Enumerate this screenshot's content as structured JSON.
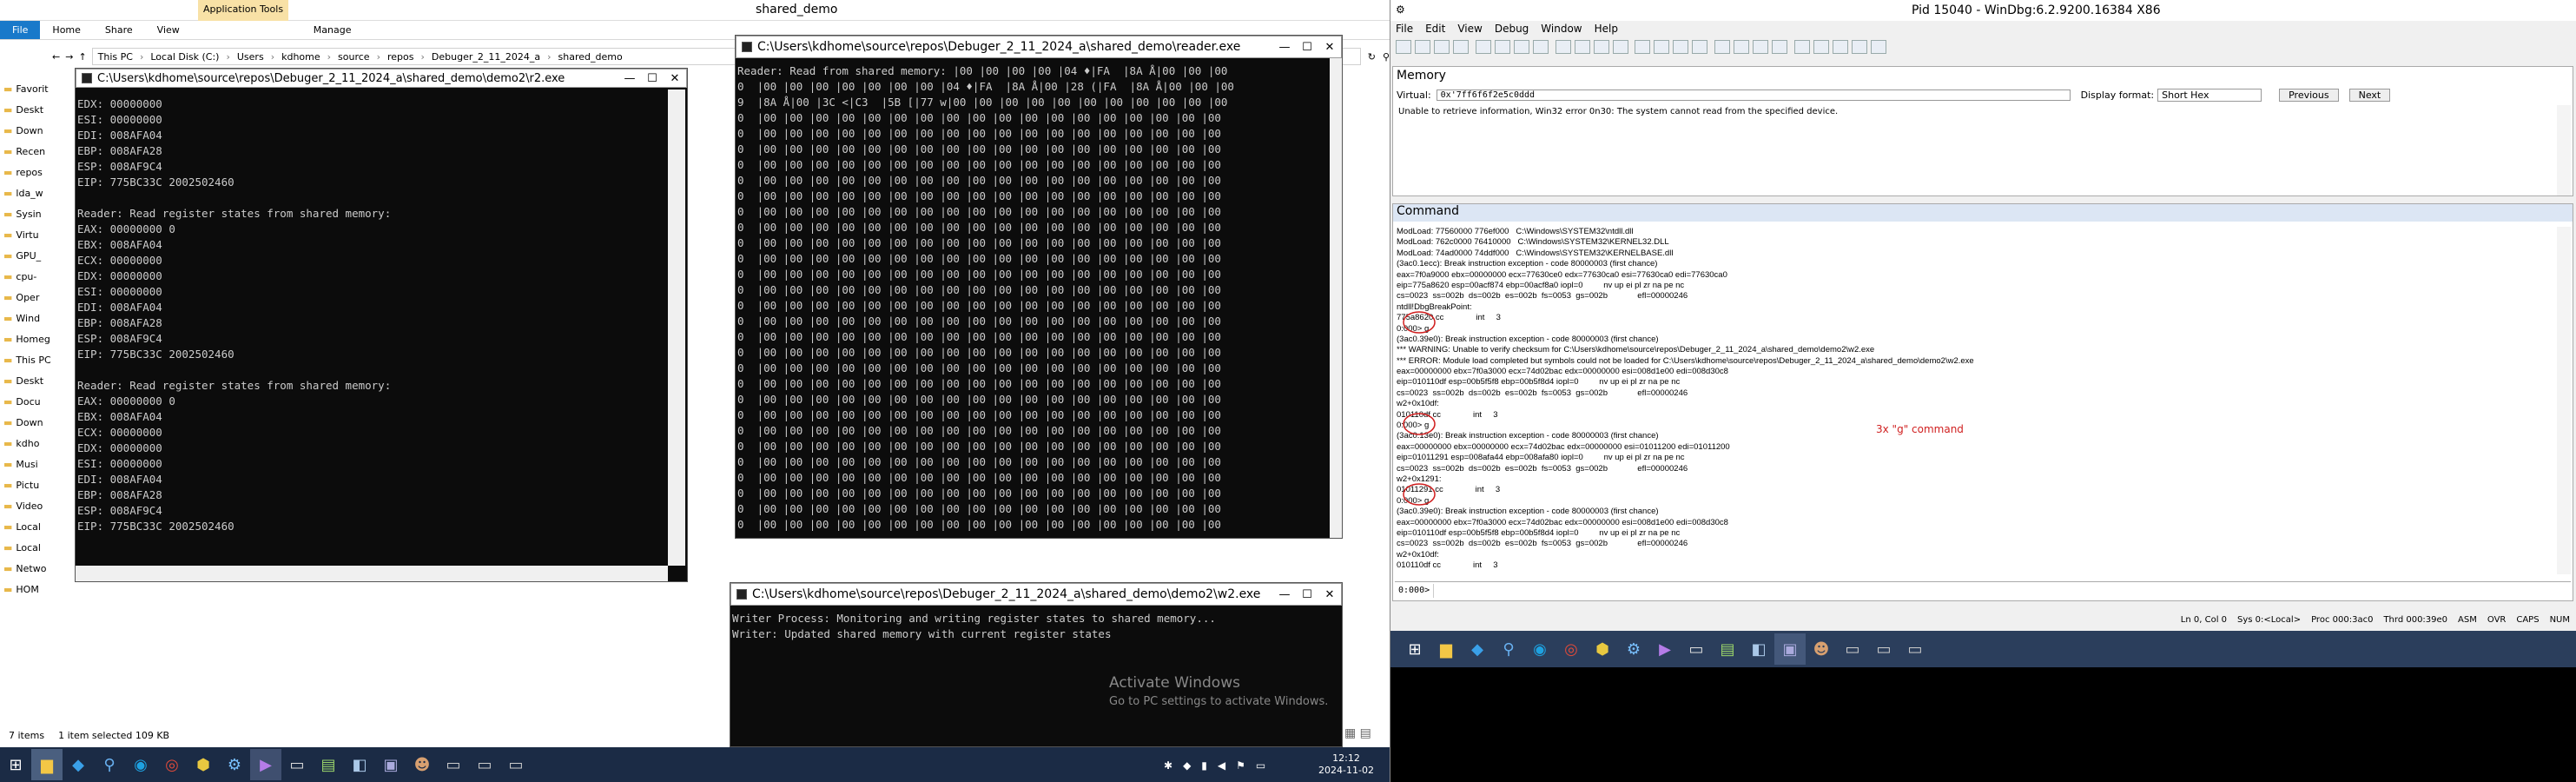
{
  "explorer": {
    "title": "shared_demo",
    "ribbon_context_tab": "Application Tools",
    "tabs": [
      "File",
      "Home",
      "Share",
      "View",
      "Manage"
    ],
    "breadcrumb": [
      "This PC",
      "Local Disk (C:)",
      "Users",
      "kdhome",
      "source",
      "repos",
      "Debuger_2_11_2024_a",
      "shared_demo"
    ],
    "nav_items": [
      "Favorit",
      "Deskt",
      "Down",
      "Recen",
      "repos",
      "lda_w",
      "Sysin",
      "Virtu",
      "GPU_",
      "cpu-",
      "Oper",
      "Wind",
      "Homeg",
      "This PC",
      "Deskt",
      "Docu",
      "Down",
      "kdho",
      "Musi",
      "Pictu",
      "Video",
      "Local",
      "Local",
      "Netwo",
      "HOM"
    ],
    "status_items": "7 items",
    "status_selected": "1 item selected  109 KB"
  },
  "r2": {
    "title": "C:\\Users\\kdhome\\source\\repos\\Debuger_2_11_2024_a\\shared_demo\\demo2\\r2.exe",
    "lines": [
      "EDX: 00000000",
      "ESI: 00000000",
      "EDI: 008AFA04",
      "EBP: 008AFA28",
      "ESP: 008AF9C4",
      "EIP: 775BC33C 2002502460",
      "",
      "Reader: Read register states from shared memory:",
      "EAX: 00000000 0",
      "EBX: 008AFA04",
      "ECX: 00000000",
      "EDX: 00000000",
      "ESI: 00000000",
      "EDI: 008AFA04",
      "EBP: 008AFA28",
      "ESP: 008AF9C4",
      "EIP: 775BC33C 2002502460",
      "",
      "Reader: Read register states from shared memory:",
      "EAX: 00000000 0",
      "EBX: 008AFA04",
      "ECX: 00000000",
      "EDX: 00000000",
      "ESI: 00000000",
      "EDI: 008AFA04",
      "EBP: 008AFA28",
      "ESP: 008AF9C4",
      "EIP: 775BC33C 2002502460"
    ]
  },
  "reader": {
    "title": "C:\\Users\\kdhome\\source\\repos\\Debuger_2_11_2024_a\\shared_demo\\reader.exe",
    "lines": [
      "Reader: Read from shared memory: |00 |00 |00 |00 |04 ♦|FA  |8A Å|00 |00 |00",
      "0  |00 |00 |00 |00 |00 |00 |00 |04 ♦|FA  |8A Å|00 |28 (|FA  |8A Å|00 |00 |00",
      "9  |8A Å|00 |3C <|C3  |5B [|77 w|00 |00 |00 |00 |00 |00 |00 |00 |00 |00 |00",
      "0  |00 |00 |00 |00 |00 |00 |00 |00 |00 |00 |00 |00 |00 |00 |00 |00 |00 |00",
      "0  |00 |00 |00 |00 |00 |00 |00 |00 |00 |00 |00 |00 |00 |00 |00 |00 |00 |00",
      "0  |00 |00 |00 |00 |00 |00 |00 |00 |00 |00 |00 |00 |00 |00 |00 |00 |00 |00",
      "0  |00 |00 |00 |00 |00 |00 |00 |00 |00 |00 |00 |00 |00 |00 |00 |00 |00 |00",
      "0  |00 |00 |00 |00 |00 |00 |00 |00 |00 |00 |00 |00 |00 |00 |00 |00 |00 |00",
      "0  |00 |00 |00 |00 |00 |00 |00 |00 |00 |00 |00 |00 |00 |00 |00 |00 |00 |00",
      "0  |00 |00 |00 |00 |00 |00 |00 |00 |00 |00 |00 |00 |00 |00 |00 |00 |00 |00",
      "0  |00 |00 |00 |00 |00 |00 |00 |00 |00 |00 |00 |00 |00 |00 |00 |00 |00 |00",
      "0  |00 |00 |00 |00 |00 |00 |00 |00 |00 |00 |00 |00 |00 |00 |00 |00 |00 |00",
      "0  |00 |00 |00 |00 |00 |00 |00 |00 |00 |00 |00 |00 |00 |00 |00 |00 |00 |00",
      "0  |00 |00 |00 |00 |00 |00 |00 |00 |00 |00 |00 |00 |00 |00 |00 |00 |00 |00",
      "0  |00 |00 |00 |00 |00 |00 |00 |00 |00 |00 |00 |00 |00 |00 |00 |00 |00 |00",
      "0  |00 |00 |00 |00 |00 |00 |00 |00 |00 |00 |00 |00 |00 |00 |00 |00 |00 |00",
      "0  |00 |00 |00 |00 |00 |00 |00 |00 |00 |00 |00 |00 |00 |00 |00 |00 |00 |00",
      "0  |00 |00 |00 |00 |00 |00 |00 |00 |00 |00 |00 |00 |00 |00 |00 |00 |00 |00",
      "0  |00 |00 |00 |00 |00 |00 |00 |00 |00 |00 |00 |00 |00 |00 |00 |00 |00 |00",
      "0  |00 |00 |00 |00 |00 |00 |00 |00 |00 |00 |00 |00 |00 |00 |00 |00 |00 |00",
      "0  |00 |00 |00 |00 |00 |00 |00 |00 |00 |00 |00 |00 |00 |00 |00 |00 |00 |00",
      "0  |00 |00 |00 |00 |00 |00 |00 |00 |00 |00 |00 |00 |00 |00 |00 |00 |00 |00",
      "0  |00 |00 |00 |00 |00 |00 |00 |00 |00 |00 |00 |00 |00 |00 |00 |00 |00 |00",
      "0  |00 |00 |00 |00 |00 |00 |00 |00 |00 |00 |00 |00 |00 |00 |00 |00 |00 |00",
      "0  |00 |00 |00 |00 |00 |00 |00 |00 |00 |00 |00 |00 |00 |00 |00 |00 |00 |00",
      "0  |00 |00 |00 |00 |00 |00 |00 |00 |00 |00 |00 |00 |00 |00 |00 |00 |00 |00",
      "0  |00 |00 |00 |00 |00 |00 |00 |00 |00 |00 |00 |00 |00 |00 |00 |00 |00 |00",
      "0  |00 |00 |00 |00 |00 |00 |00 |00 |00 |00 |00 |00 |00 |00 |00 |00 |00 |00",
      "0  |00 |00 |00 |00 |00 |00 |00 |00 |00 |00 |00 |00 |00 |00 |00 |00 |00 |00",
      "0  |00 |00 |00 |00 |00 |00 |00 |00 |00 |00 |00 |00 |00 |00 |00 |00 |00 |00"
    ]
  },
  "w2": {
    "title": "C:\\Users\\kdhome\\source\\repos\\Debuger_2_11_2024_a\\shared_demo\\demo2\\w2.exe",
    "lines": [
      "Writer Process: Monitoring and writing register states to shared memory...",
      "Writer: Updated shared memory with current register states"
    ],
    "activate_title": "Activate Windows",
    "activate_sub": "Go to PC settings to activate Windows."
  },
  "windbg": {
    "title": "Pid 15040 - WinDbg:6.2.9200.16384 X86",
    "menu": [
      "File",
      "Edit",
      "View",
      "Debug",
      "Window",
      "Help"
    ],
    "memory_title": "Memory",
    "virtual_label": "Virtual:",
    "virtual_value": "0x'7ff6f6f2e5c0ddd",
    "display_format_label": "Display format:",
    "display_format_value": "Short Hex",
    "prev_btn": "Previous",
    "next_btn": "Next",
    "memory_error": "Unable to retrieve information, Win32 error 0n30: The system cannot read from the specified device.",
    "command_title": "Command",
    "command_lines": [
      "ModLoad: 77560000 776ef000   C:\\Windows\\SYSTEM32\\ntdll.dll",
      "ModLoad: 762c0000 76410000   C:\\Windows\\SYSTEM32\\KERNEL32.DLL",
      "ModLoad: 74ad0000 74ddf000   C:\\Windows\\SYSTEM32\\KERNELBASE.dll",
      "(3ac0.1ecc): Break instruction exception - code 80000003 (first chance)",
      "eax=7f0a9000 ebx=00000000 ecx=77630ce0 edx=77630ca0 esi=77630ca0 edi=77630ca0",
      "eip=775a8620 esp=00acf874 ebp=00acf8a0 iopl=0         nv up ei pl zr na pe nc",
      "cs=0023  ss=002b  ds=002b  es=002b  fs=0053  gs=002b             efl=00000246",
      "ntdll!DbgBreakPoint:",
      "775a8620 cc              int     3",
      "0:000> g",
      "(3ac0.39e0): Break instruction exception - code 80000003 (first chance)",
      "*** WARNING: Unable to verify checksum for C:\\Users\\kdhome\\source\\repos\\Debuger_2_11_2024_a\\shared_demo\\demo2\\w2.exe",
      "*** ERROR: Module load completed but symbols could not be loaded for C:\\Users\\kdhome\\source\\repos\\Debuger_2_11_2024_a\\shared_demo\\demo2\\w2.exe",
      "eax=00000000 ebx=7f0a3000 ecx=74d02bac edx=00000000 esi=008d1e00 edi=008d30c8",
      "eip=010110df esp=00b5f5f8 ebp=00b5f8d4 iopl=0         nv up ei pl zr na pe nc",
      "cs=0023  ss=002b  ds=002b  es=002b  fs=0053  gs=002b             efl=00000246",
      "w2+0x10df:",
      "010110df cc              int     3",
      "0:000> g",
      "(3ac0.13e0): Break instruction exception - code 80000003 (first chance)",
      "eax=00000000 ebx=00000000 ecx=74d02bac edx=00000000 esi=01011200 edi=01011200",
      "eip=01011291 esp=008afa44 ebp=008afa80 iopl=0         nv up ei pl zr na pe nc",
      "cs=0023  ss=002b  ds=002b  es=002b  fs=0053  gs=002b             efl=00000246",
      "w2+0x1291:",
      "01011291 cc              int     3",
      "0:000> g",
      "(3ac0.39e0): Break instruction exception - code 80000003 (first chance)",
      "eax=00000000 ebx=7f0a3000 ecx=74d02bac edx=00000000 esi=008d1e00 edi=008d30c8",
      "eip=010110df esp=00b5f5f8 ebp=00b5f8d4 iopl=0         nv up ei pl zr na pe nc",
      "cs=0023  ss=002b  ds=002b  es=002b  fs=0053  gs=002b             efl=00000246",
      "w2+0x10df:",
      "010110df cc              int     3"
    ],
    "annotation": "3x \"g\" command",
    "prompt": "0:000>",
    "status": [
      "Ln 0, Col 0",
      "Sys 0:<Local>",
      "Proc 000:3ac0",
      "Thrd 000:39e0",
      "ASM",
      "OVR",
      "CAPS",
      "NUM"
    ]
  },
  "taskbar": {
    "time": "12:12",
    "date": "2024-11-02"
  }
}
